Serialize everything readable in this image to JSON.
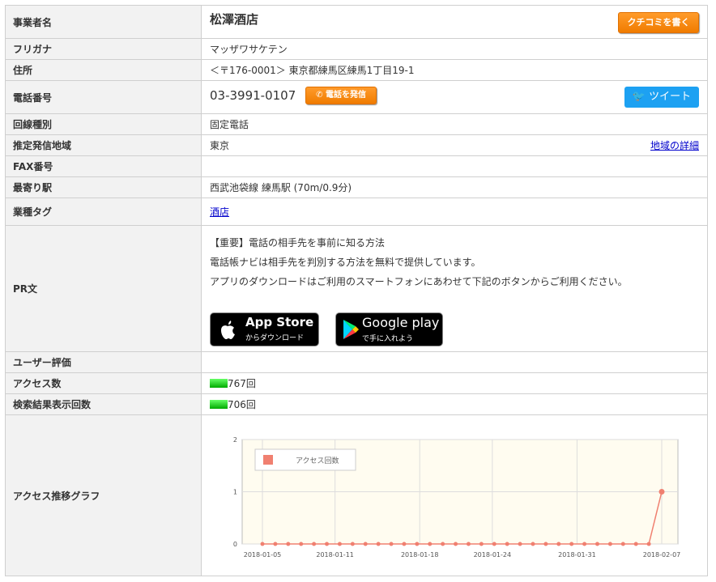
{
  "labels": {
    "name": "事業者名",
    "furigana": "フリガナ",
    "address": "住所",
    "tel": "電話番号",
    "line_type": "回線種別",
    "region": "推定発信地域",
    "fax": "FAX番号",
    "station": "最寄り駅",
    "tag": "業種タグ",
    "pr": "PR文",
    "rating": "ユーザー評価",
    "access": "アクセス数",
    "search": "検索結果表示回数",
    "graph": "アクセス推移グラフ"
  },
  "business": {
    "name": "松澤酒店",
    "kuchikomi_button": "クチコミを書く",
    "furigana": "マッザワサケテン",
    "address": "＜〒176-0001＞ 東京都練馬区練馬1丁目19-1",
    "tel": "03-3991-0107",
    "call_button": "電話を発信",
    "tweet_button": "ツイート",
    "line_type": "固定電話",
    "region": "東京",
    "region_link": "地域の詳細",
    "fax": "",
    "station": "西武池袋線 練馬駅 (70m/0.9分)",
    "tag": "酒店",
    "rating": ""
  },
  "pr": {
    "line1": "【重要】電話の相手先を事前に知る方法",
    "line2": "電話帳ナビは相手先を判別する方法を無料で提供しています。",
    "line3": "アプリのダウンロードはご利用のスマートフォンにあわせて下記のボタンからご利用ください。",
    "appstore_title": "App Store",
    "appstore_sub": "からダウンロード",
    "googleplay_title": "Google play",
    "googleplay_sub": "で手に入れよう"
  },
  "stats": {
    "access_count": "767回",
    "search_count": "706回"
  },
  "colors": {
    "series": "#f08070",
    "plot_bg": "#fffcf0",
    "orange": "#f07c00",
    "twitter": "#1da1f2"
  },
  "chart_data": {
    "type": "line",
    "title": "",
    "xlabel": "",
    "ylabel": "",
    "ylim": [
      0,
      2
    ],
    "yticks": [
      "0",
      "1",
      "2"
    ],
    "xticks": [
      "2018-01-05",
      "2018-01-11",
      "2018-01-18",
      "2018-01-24",
      "2018-01-31",
      "2018-02-07"
    ],
    "legend": "top-left",
    "series": [
      {
        "name": "アクセス回数",
        "values": [
          0,
          0,
          0,
          0,
          0,
          0,
          0,
          0,
          0,
          0,
          0,
          0,
          0,
          0,
          0,
          0,
          0,
          0,
          0,
          0,
          0,
          0,
          0,
          0,
          0,
          0,
          0,
          0,
          0,
          0,
          0,
          1
        ]
      }
    ]
  }
}
